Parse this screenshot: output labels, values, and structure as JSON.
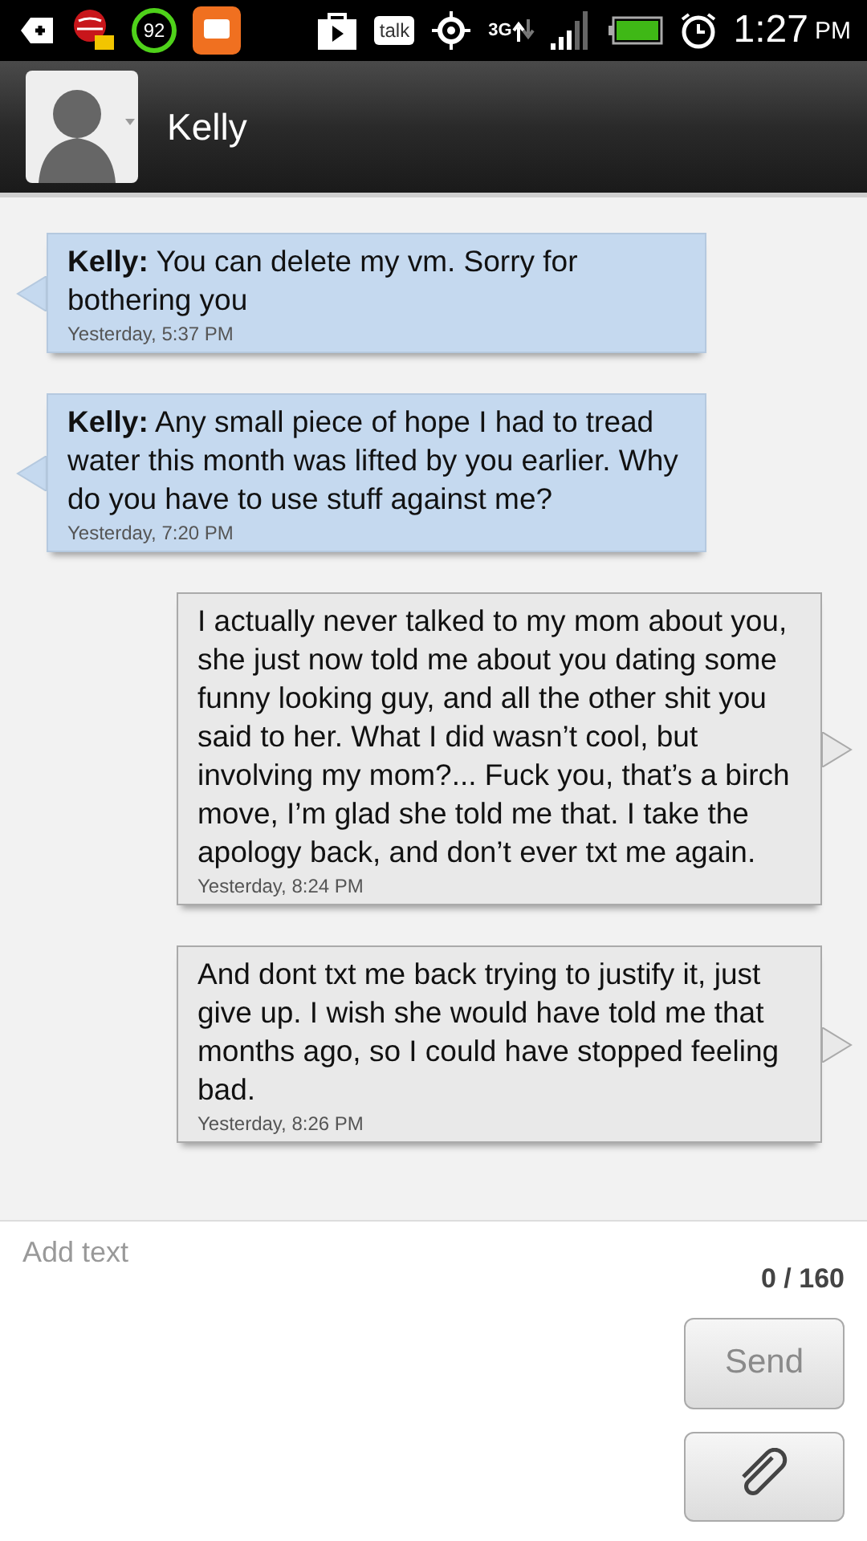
{
  "status_bar": {
    "battery_saver_badge": "92",
    "talk_label": "talk",
    "network": "3G",
    "time": "1:27",
    "period": "PM"
  },
  "header": {
    "contact_name": "Kelly"
  },
  "messages": [
    {
      "kind": "incoming",
      "text": "**Kelly:** You can delete my vm. Sorry for bothering you",
      "time": "Yesterday, 5:37 PM"
    },
    {
      "kind": "incoming",
      "text": "**Kelly:** Any small piece of hope I had to tread water this month was lifted by you earlier. Why do you have to use stuff against me?",
      "time": "Yesterday, 7:20 PM"
    },
    {
      "kind": "outgoing",
      "text": "I actually never talked to my mom about you, she just now told me about you dating some funny looking guy, and all the other shit you said to her. What I did wasn’t cool, but involving my mom?... Fuck you, that’s a birch move, I’m glad she told me that. I take the apology back, and don’t ever txt me again.",
      "time": "Yesterday, 8:24 PM"
    },
    {
      "kind": "outgoing",
      "text": "And dont txt me back trying to justify it, just give up. I wish she would have told me that months ago, so I could have stopped feeling bad.",
      "time": "Yesterday, 8:26 PM"
    }
  ],
  "compose": {
    "placeholder": "Add text",
    "counter": "0 / 160",
    "send_button": {
      "label": "Send",
      "disabled": true
    }
  }
}
